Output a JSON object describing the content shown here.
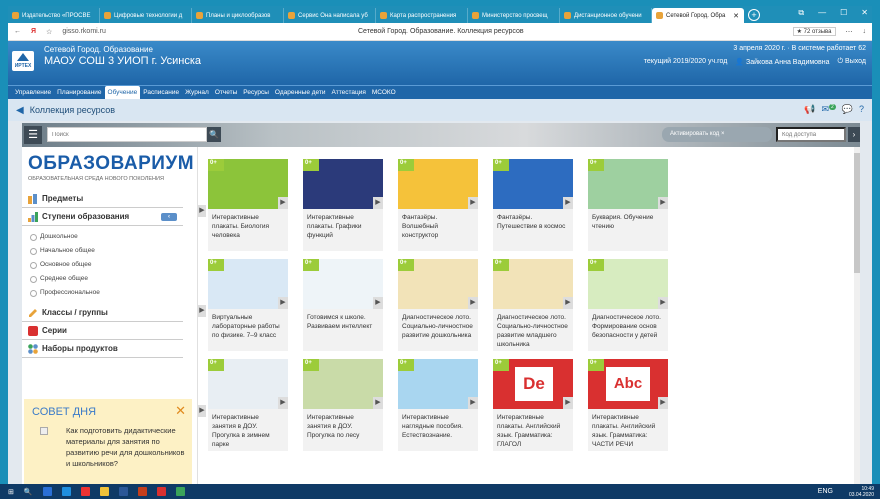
{
  "browser": {
    "tabs": [
      {
        "label": "Издательство «ПРОСВЕ",
        "active": false
      },
      {
        "label": "Цифровые технологии д",
        "active": false
      },
      {
        "label": "Планы и циклообразов",
        "active": false
      },
      {
        "label": "Сервис Она написала уб",
        "active": false
      },
      {
        "label": "Карта распространения",
        "active": false
      },
      {
        "label": "Министерство просвещ",
        "active": false
      },
      {
        "label": "Дистанционное обучени",
        "active": false
      },
      {
        "label": "Сетевой Город. Обра",
        "active": true
      }
    ],
    "new_tab": "+",
    "window_controls": [
      "⧉",
      "—",
      "☐",
      "✕"
    ],
    "back": "←",
    "reload": "Я",
    "star": "☆",
    "url": "gisso.rkomi.ru",
    "page_title": "Сетевой Город. Образование. Коллекция ресурсов",
    "rating": "★ 72 отзыва",
    "toolbar_icons": [
      "⋯",
      "↓"
    ]
  },
  "header": {
    "subtitle": "Сетевой Город. Образование",
    "school": "МАОУ СОШ 3 УИОП г. Усинска",
    "logo_text": "ИРТЕХ",
    "date_line": "3 апреля 2020 г. · В системе работает 62",
    "year": "текущий 2019/2020 уч.год",
    "user": "Зайкова Анна Вадимовна",
    "logout": "Выход",
    "user_icon": "👤",
    "logout_icon": "⏻"
  },
  "menu": [
    {
      "label": "Управление",
      "active": false
    },
    {
      "label": "Планирование",
      "active": false
    },
    {
      "label": "Обучение",
      "active": true
    },
    {
      "label": "Расписание",
      "active": false
    },
    {
      "label": "Журнал",
      "active": false
    },
    {
      "label": "Отчеты",
      "active": false
    },
    {
      "label": "Ресурсы",
      "active": false
    },
    {
      "label": "Одаренные дети",
      "active": false
    },
    {
      "label": "Аттестация",
      "active": false
    },
    {
      "label": "МСОКО",
      "active": false
    }
  ],
  "collection": {
    "back": "◀",
    "title": "Коллекция ресурсов",
    "badge": "2",
    "icons": [
      "📢",
      "✉",
      "💬",
      "?"
    ]
  },
  "catalog": {
    "burger": "☰",
    "search_placeholder": "Поиск",
    "search_icon": "🔍",
    "activation_code": "Активировать код",
    "activation_close": "×",
    "find_placeholder": "Код доступа",
    "find_arrow": "›",
    "brand": "ОБРАЗОВАРИУМ",
    "brand_sub": "ОБРАЗОВАТЕЛЬНАЯ СРЕДА НОВОГО ПОКОЛЕНИЯ",
    "sections": {
      "subjects": "Предметы",
      "levels": "Ступени образования",
      "classes": "Классы / группы",
      "series": "Серии",
      "product_sets": "Наборы продуктов"
    },
    "chevron": "‹",
    "levels": [
      "Дошкольное",
      "Начальное общее",
      "Основное общее",
      "Среднее общее",
      "Профессиональное"
    ],
    "tip": {
      "title": "СОВЕТ ДНЯ",
      "close": "✕",
      "text": "Как подготовить дидактические материалы для занятия по развитию речи для дошкольников и школьников?"
    },
    "ribbon": "0+",
    "play": "▶",
    "cards": [
      {
        "title": "Интерактивные плакаты. Биология человека",
        "color": "#8cc43a"
      },
      {
        "title": "Интерактивные плакаты. Графики функций",
        "color": "#2b3a7a"
      },
      {
        "title": "Фантазёры. Волшебный конструктор",
        "color": "#f5c23a"
      },
      {
        "title": "Фантазёры. Путешествие в космос",
        "color": "#2d6cc0"
      },
      {
        "title": "Буквария. Обучение чтению",
        "color": "#9ed0a0"
      },
      {
        "title": "Виртуальные лабораторные работы по физике. 7–9 класс",
        "color": "#d9e8f5"
      },
      {
        "title": "Готовимся к школе. Развиваем интеллект",
        "color": "#eef4f8"
      },
      {
        "title": "Диагностическое лото. Социально-личностное развитие дошкольника",
        "color": "#f2e3b8"
      },
      {
        "title": "Диагностическое лото. Социально-личностное развитие младшего школьника",
        "color": "#f2e3b8"
      },
      {
        "title": "Диагностическое лото. Формирование основ безопасности у детей",
        "color": "#d7ecc0"
      },
      {
        "title": "Интерактивные занятия в ДОУ. Прогулка в зимнем парке",
        "color": "#e8eef3"
      },
      {
        "title": "Интерактивные занятия в ДОУ. Прогулка по лесу",
        "color": "#c9dba8"
      },
      {
        "title": "Интерактивные наглядные пособия. Естествознание.",
        "color": "#a9d6f0"
      },
      {
        "title": "Интерактивные плакаты. Английский язык. Грамматика: ГЛАГОЛ",
        "color": "#d93030"
      },
      {
        "title": "Интерактивные плакаты. Английский язык. Грамматика: ЧАСТИ РЕЧИ",
        "color": "#d93030"
      }
    ],
    "card_letters": {
      "glagol": "De",
      "chasti": "Abc"
    }
  },
  "taskbar": {
    "start": "⊞",
    "search": "🔍",
    "lang": "ENG",
    "time": "10:49",
    "date": "03.04.2020"
  }
}
